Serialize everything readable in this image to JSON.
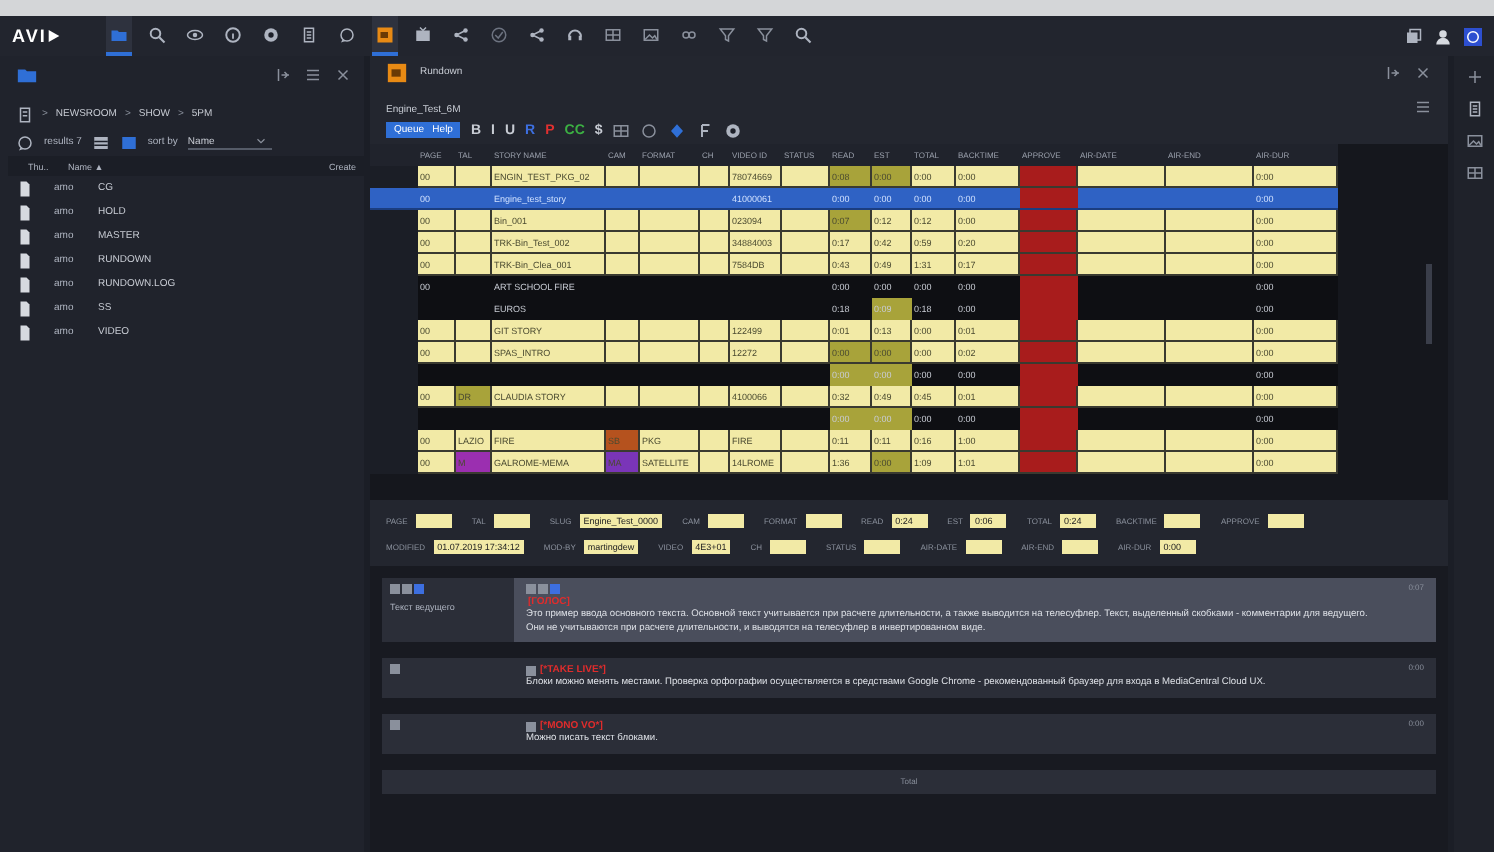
{
  "topbar": {
    "logo": "AVI",
    "tools": [
      {
        "kind": "folder",
        "selected": true
      },
      {
        "kind": "search",
        "selected": false
      },
      {
        "kind": "eye",
        "selected": false
      },
      {
        "kind": "info",
        "selected": false
      },
      {
        "kind": "gear",
        "selected": false
      },
      {
        "kind": "document",
        "selected": false
      },
      {
        "kind": "chat",
        "selected": false
      },
      {
        "kind": "rundown",
        "selected": true
      },
      {
        "kind": "monitor",
        "selected": false
      },
      {
        "kind": "share",
        "selected": false
      },
      {
        "kind": "check",
        "selected": false
      },
      {
        "kind": "share",
        "selected": false
      },
      {
        "kind": "headset",
        "selected": false
      },
      {
        "kind": "grid",
        "selected": false
      },
      {
        "kind": "image",
        "selected": false
      },
      {
        "kind": "link",
        "selected": false
      },
      {
        "kind": "filter",
        "selected": false
      },
      {
        "kind": "filter",
        "selected": false
      },
      {
        "kind": "search",
        "selected": false
      }
    ]
  },
  "browser": {
    "breadcrumb": [
      {
        "sep": ">",
        "label": "NEWSROOM"
      },
      {
        "sep": ">",
        "label": "SHOW"
      },
      {
        "sep": ">",
        "label": "5PM"
      }
    ],
    "results": "results 7",
    "sort_label": "sort by",
    "sort_value": "Name",
    "columns": [
      "Thu..",
      "Name ▲",
      "Create"
    ],
    "items": [
      {
        "type": "amo",
        "name": "CG"
      },
      {
        "type": "amo",
        "name": "HOLD"
      },
      {
        "type": "amo",
        "name": "MASTER"
      },
      {
        "type": "amo",
        "name": "RUNDOWN"
      },
      {
        "type": "amo",
        "name": "RUNDOWN.LOG"
      },
      {
        "type": "amo",
        "name": "SS"
      },
      {
        "type": "amo",
        "name": "VIDEO"
      }
    ]
  },
  "rundown": {
    "title": "Rundown",
    "tab": "Engine_Test_6M",
    "queue_button": "Queue   Help",
    "format_tools": [
      {
        "text": "B",
        "color": "#c8ccd4"
      },
      {
        "text": "I",
        "color": "#c8ccd4"
      },
      {
        "text": "U",
        "color": "#c8ccd4"
      },
      {
        "text": "R",
        "color": "#3d6fe0"
      },
      {
        "text": "P",
        "color": "#e03030"
      },
      {
        "text": "CC",
        "color": "#3cb043"
      },
      {
        "text": "$",
        "color": "#c8ccd4"
      }
    ],
    "columns": [
      {
        "name": "PAGE"
      },
      {
        "name": "TAL"
      },
      {
        "name": "STORY NAME"
      },
      {
        "name": "CAM"
      },
      {
        "name": "FORMAT"
      },
      {
        "name": "CH"
      },
      {
        "name": "VIDEO ID"
      },
      {
        "name": "STATUS"
      },
      {
        "name": "READ"
      },
      {
        "name": "EST"
      },
      {
        "name": "TOTAL"
      },
      {
        "name": "BACKTIME"
      },
      {
        "name": "APPROVE",
        "color": "#a81c1c"
      },
      {
        "name": "AIR-DATE"
      },
      {
        "name": "AIR-END"
      },
      {
        "name": "AIR-DUR"
      }
    ],
    "rows": [
      {
        "kind": "story",
        "selected": false,
        "cells": [
          {
            "text": "00"
          },
          {},
          {
            "text": "ENGIN_TEST_PKG_02"
          },
          {},
          {},
          {},
          {
            "text": "78074669"
          },
          {},
          {
            "text": "0:08",
            "color": "#a8a33a"
          },
          {
            "text": "0:00",
            "color": "#a8a33a"
          },
          {
            "text": "0:00"
          },
          {
            "text": "0:00"
          },
          {},
          {},
          {},
          {
            "text": "0:00"
          }
        ]
      },
      {
        "kind": "story",
        "selected": true,
        "cells": [
          {
            "text": "00"
          },
          {},
          {
            "text": "Engine_test_story"
          },
          {},
          {},
          {},
          {
            "text": "41000061"
          },
          {},
          {
            "text": "0:00"
          },
          {
            "text": "0:00"
          },
          {
            "text": "0:00"
          },
          {
            "text": "0:00"
          },
          {},
          {},
          {},
          {
            "text": "0:00"
          }
        ]
      },
      {
        "kind": "story",
        "selected": false,
        "cells": [
          {
            "text": "00"
          },
          {},
          {
            "text": "Bin_001"
          },
          {},
          {},
          {},
          {
            "text": "023094"
          },
          {},
          {
            "text": "0:07",
            "color": "#a8a33a"
          },
          {
            "text": "0:12"
          },
          {
            "text": "0:12"
          },
          {
            "text": "0:00"
          },
          {},
          {},
          {},
          {
            "text": "0:00"
          }
        ]
      },
      {
        "kind": "story",
        "selected": false,
        "cells": [
          {
            "text": "00"
          },
          {},
          {
            "text": "TRK-Bin_Test_002"
          },
          {},
          {},
          {},
          {
            "text": "34884003"
          },
          {},
          {
            "text": "0:17"
          },
          {
            "text": "0:42"
          },
          {
            "text": "0:59"
          },
          {
            "text": "0:20"
          },
          {},
          {},
          {},
          {
            "text": "0:00"
          }
        ]
      },
      {
        "kind": "story",
        "selected": false,
        "cells": [
          {
            "text": "00"
          },
          {},
          {
            "text": "TRK-Bin_Clea_001"
          },
          {},
          {},
          {},
          {
            "text": "7584DB"
          },
          {},
          {
            "text": "0:43"
          },
          {
            "text": "0:49"
          },
          {
            "text": "1:31"
          },
          {
            "text": "0:17"
          },
          {},
          {},
          {},
          {
            "text": "0:00"
          }
        ]
      },
      {
        "kind": "break",
        "selected": false,
        "cells": [
          {
            "text": "00"
          },
          {},
          {
            "text": "ART SCHOOL FIRE"
          },
          {},
          {},
          {},
          {},
          {},
          {
            "text": "0:00"
          },
          {
            "text": "0:00"
          },
          {
            "text": "0:00"
          },
          {
            "text": "0:00"
          },
          {},
          {},
          {},
          {
            "text": "0:00"
          }
        ]
      },
      {
        "kind": "break",
        "selected": false,
        "cells": [
          {},
          {},
          {
            "text": "EUROS"
          },
          {},
          {},
          {},
          {},
          {},
          {
            "text": "0:18"
          },
          {
            "text": "0:09",
            "color": "#a8a33a"
          },
          {
            "text": "0:18"
          },
          {
            "text": "0:00"
          },
          {},
          {},
          {},
          {
            "text": "0:00"
          }
        ]
      },
      {
        "kind": "story",
        "selected": false,
        "cells": [
          {
            "text": "00"
          },
          {},
          {
            "text": "GIT STORY"
          },
          {},
          {},
          {},
          {
            "text": "122499"
          },
          {},
          {
            "text": "0:01"
          },
          {
            "text": "0:13"
          },
          {
            "text": "0:00"
          },
          {
            "text": "0:01"
          },
          {},
          {},
          {},
          {
            "text": "0:00"
          }
        ]
      },
      {
        "kind": "story",
        "selected": false,
        "cells": [
          {
            "text": "00"
          },
          {},
          {
            "text": "SPAS_INTRO"
          },
          {},
          {},
          {},
          {
            "text": "12272"
          },
          {},
          {
            "text": "0:00",
            "color": "#a8a33a"
          },
          {
            "text": "0:00",
            "color": "#a8a33a"
          },
          {
            "text": "0:00"
          },
          {
            "text": "0:02"
          },
          {},
          {},
          {},
          {
            "text": "0:00"
          }
        ]
      },
      {
        "kind": "break",
        "selected": false,
        "cells": [
          {},
          {},
          {},
          {},
          {},
          {},
          {},
          {},
          {
            "text": "0:00",
            "color": "#a8a33a"
          },
          {
            "text": "0:00",
            "color": "#a8a33a"
          },
          {
            "text": "0:00"
          },
          {
            "text": "0:00"
          },
          {},
          {},
          {},
          {
            "text": "0:00"
          }
        ]
      },
      {
        "kind": "story",
        "selected": false,
        "cells": [
          {
            "text": "00"
          },
          {
            "text": "DR",
            "color": "#a8a33a"
          },
          {
            "text": "CLAUDIA STORY"
          },
          {},
          {},
          {},
          {
            "text": "4100066"
          },
          {},
          {
            "text": "0:32"
          },
          {
            "text": "0:49"
          },
          {
            "text": "0:45"
          },
          {
            "text": "0:01"
          },
          {},
          {},
          {},
          {
            "text": "0:00"
          }
        ]
      },
      {
        "kind": "break",
        "selected": false,
        "cells": [
          {},
          {},
          {},
          {},
          {},
          {},
          {},
          {},
          {
            "text": "0:00",
            "color": "#a8a33a"
          },
          {
            "text": "0:00",
            "color": "#a8a33a"
          },
          {
            "text": "0:00"
          },
          {
            "text": "0:00"
          },
          {},
          {},
          {},
          {
            "text": "0:00"
          }
        ]
      },
      {
        "kind": "story",
        "selected": false,
        "cells": [
          {
            "text": "00"
          },
          {
            "text": "LAZIO"
          },
          {
            "text": "FIRE"
          },
          {
            "text": "SB",
            "color": "#b5521e"
          },
          {
            "text": "PKG"
          },
          {},
          {
            "text": "FIRE"
          },
          {},
          {
            "text": "0:11"
          },
          {
            "text": "0:11"
          },
          {
            "text": "0:16"
          },
          {
            "text": "1:00"
          },
          {},
          {},
          {},
          {
            "text": "0:00"
          }
        ]
      },
      {
        "kind": "story",
        "selected": false,
        "cells": [
          {
            "text": "00"
          },
          {
            "text": "M",
            "color": "#9b2fb0"
          },
          {
            "text": "GALROME-MEMA"
          },
          {
            "text": "MA",
            "color": "#7a35b8"
          },
          {
            "text": "SATELLITE"
          },
          {},
          {
            "text": "14LROME"
          },
          {},
          {
            "text": "1:36"
          },
          {
            "text": "0:00",
            "color": "#a8a33a"
          },
          {
            "text": "1:09"
          },
          {
            "text": "1:01"
          },
          {},
          {},
          {},
          {
            "text": "0:00"
          }
        ]
      }
    ],
    "field_rows": [
      [
        {
          "label": "PAGE"
        },
        {
          "label": "TAL"
        },
        {
          "label": "SLUG",
          "value": "Engine_Test_0000"
        },
        {
          "label": "CAM"
        },
        {
          "label": "FORMAT"
        },
        {
          "label": "READ",
          "value": "0:24"
        },
        {
          "label": "EST",
          "value": "0:06"
        },
        {
          "label": "TOTAL",
          "value": "0:24"
        },
        {
          "label": "BACKTIME"
        },
        {
          "label": "APPROVE"
        }
      ],
      [
        {
          "label": "MODIFIED",
          "value": "01.07.2019 17:34:12"
        },
        {
          "label": "MOD-BY",
          "value": "martingdew"
        },
        {
          "label": "VIDEO",
          "value": "4E3+01"
        },
        {
          "label": "CH"
        },
        {
          "label": "STATUS"
        },
        {
          "label": "AIR-DATE"
        },
        {
          "label": "AIR-END"
        },
        {
          "label": "AIR-DUR",
          "value": "0:00"
        }
      ]
    ],
    "blocks": [
      {
        "selected": true,
        "label": "Текст ведущего",
        "cue": "[ГОЛОС]",
        "text": "Это пример ввода основного текста. Основной текст учитывается при расчете длительности, а также выводится на телесуфлер. Текст, выделенный скобками - комментарии для ведущего. Они не учитываются при расчете длительности, и выводятся на телесуфлер в инвертированном виде.",
        "time": "0:07"
      },
      {
        "selected": false,
        "cue": "[*TAKE LIVE*]",
        "text": "Блоки можно менять местами. Проверка орфографии осуществляется в средствами Google Chrome - рекомендованный браузер для входа в MediaCentral Cloud UX.",
        "time": "0:00"
      },
      {
        "selected": false,
        "cue": "[*MONO VO*]",
        "text": "Можно писать текст блоками.",
        "time": "0:00"
      }
    ],
    "footer": "Total"
  }
}
